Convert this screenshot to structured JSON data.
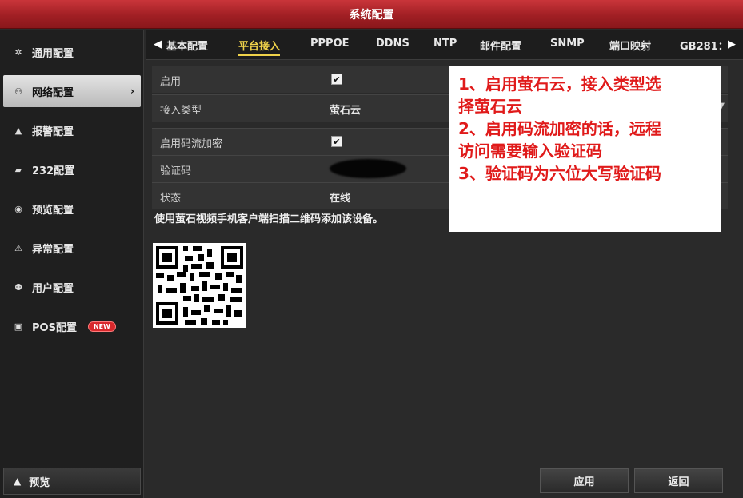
{
  "window": {
    "title": "系统配置"
  },
  "sidebar": {
    "items": [
      {
        "label": "通用配置",
        "icon": "gear-icon"
      },
      {
        "label": "网络配置",
        "icon": "network-icon",
        "active": true
      },
      {
        "label": "报警配置",
        "icon": "alarm-icon"
      },
      {
        "label": "232配置",
        "icon": "serial-icon"
      },
      {
        "label": "预览配置",
        "icon": "eye-icon"
      },
      {
        "label": "异常配置",
        "icon": "warning-icon"
      },
      {
        "label": "用户配置",
        "icon": "users-icon"
      },
      {
        "label": "POS配置",
        "icon": "pos-icon",
        "badge": "NEW"
      }
    ],
    "preview_label": "预览"
  },
  "tabs": [
    "基本配置",
    "平台接入",
    "PPPOE",
    "DDNS",
    "NTP",
    "邮件配置",
    "SNMP",
    "端口映射",
    "GB281："
  ],
  "active_tab": "平台接入",
  "form": {
    "enable_label": "启用",
    "access_type_label": "接入类型",
    "access_type_value": "萤石云",
    "encrypt_label": "启用码流加密",
    "verify_label": "验证码",
    "status_label": "状态",
    "status_value": "在线"
  },
  "qr_hint": "使用萤石视频手机客户端扫描二维码添加该设备。",
  "note": {
    "line1": "1、启用萤石云，接入类型选",
    "line2": "择萤石云",
    "line3": "2、启用码流加密的话，远程",
    "line4": "访问需要输入验证码",
    "line5": "3、验证码为六位大写验证码"
  },
  "buttons": {
    "apply": "应用",
    "back": "返回"
  },
  "colors": {
    "title_red": "#b0252a",
    "active_tab": "#f0d34a",
    "note_text": "#e01a1a"
  }
}
